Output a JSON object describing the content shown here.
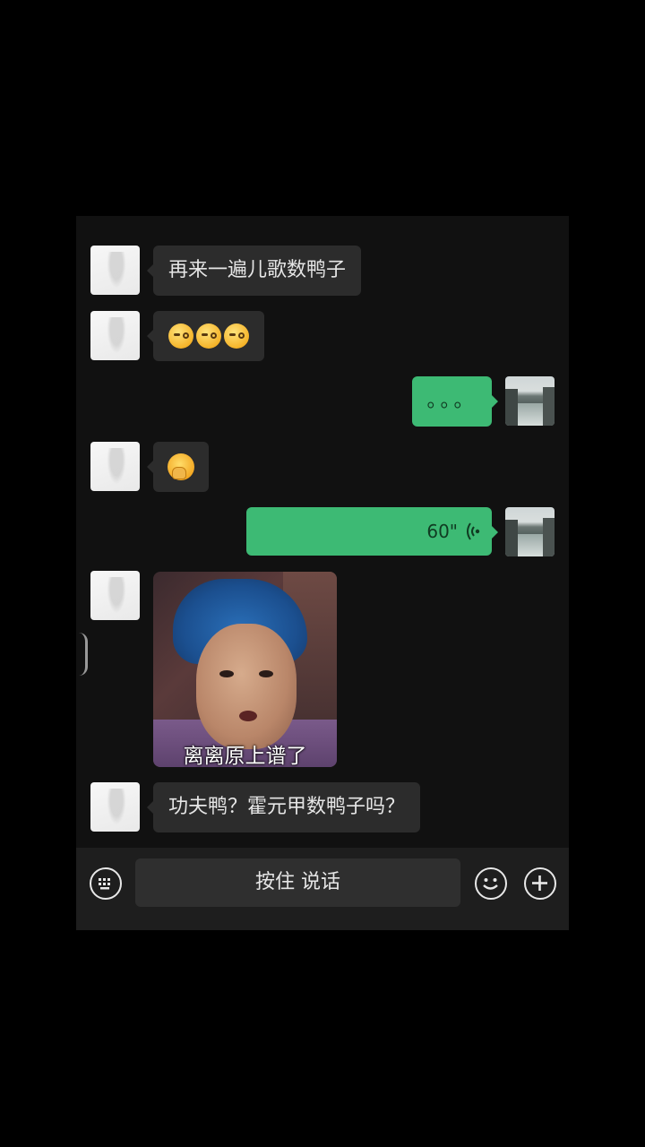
{
  "messages": [
    {
      "side": "in",
      "type": "text",
      "text": "再来一遍儿歌数鸭子"
    },
    {
      "side": "in",
      "type": "emoji",
      "emoji": [
        "face-with-monocle",
        "face-with-monocle",
        "face-with-monocle"
      ]
    },
    {
      "side": "out",
      "type": "text",
      "text": "。。。"
    },
    {
      "side": "in",
      "type": "emoji",
      "emoji": [
        "face-with-hand-over-mouth"
      ]
    },
    {
      "side": "out",
      "type": "voice",
      "duration": "60\""
    },
    {
      "side": "in",
      "type": "image",
      "caption": "离离原上谱了"
    },
    {
      "side": "in",
      "type": "text",
      "text": "功夫鸭？霍元甲数鸭子吗？"
    }
  ],
  "input_bar": {
    "keyboard_icon": "keyboard-icon",
    "hold_to_talk_label": "按住 说话",
    "emoji_icon": "smiley-icon",
    "add_icon": "plus-icon"
  },
  "colors": {
    "outgoing_bubble": "#3dba74",
    "incoming_bubble": "#2c2c2c",
    "background": "#111111"
  }
}
